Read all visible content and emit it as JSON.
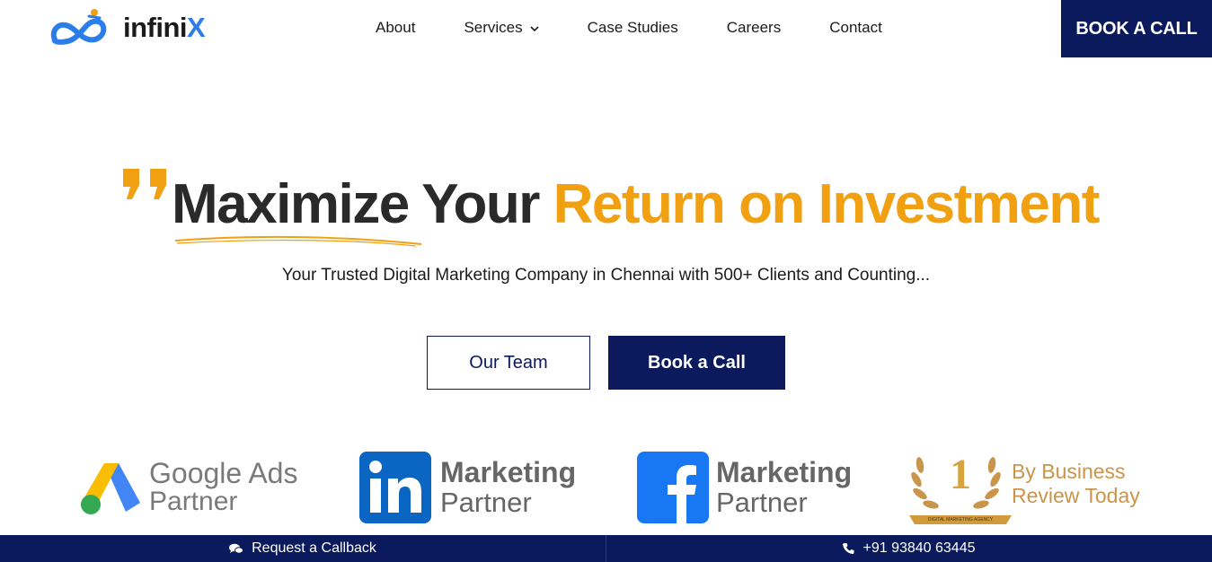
{
  "brand": {
    "name_prefix": "infini",
    "name_suffix": "X",
    "accent_color": "#2b7de9"
  },
  "nav": {
    "items": [
      {
        "label": "About"
      },
      {
        "label": "Services",
        "has_dropdown": true
      },
      {
        "label": "Case Studies"
      },
      {
        "label": "Careers"
      },
      {
        "label": "Contact"
      }
    ],
    "cta_label": "BOOK A CALL"
  },
  "hero": {
    "headline_dark": "Maximize Your",
    "headline_accent": "Return on Investment",
    "subtitle": "Your Trusted Digital Marketing Company in Chennai with 500+ Clients and Counting...",
    "buttons": {
      "team_label": "Our Team",
      "book_label": "Book a Call"
    },
    "colors": {
      "navy": "#0a1a5c",
      "orange": "#f0a011"
    }
  },
  "partners": [
    {
      "icon": "google-ads-icon",
      "line1": "Google Ads",
      "line2": "Partner"
    },
    {
      "icon": "linkedin-icon",
      "line1": "Marketing",
      "line2": "Partner"
    },
    {
      "icon": "facebook-icon",
      "line1": "Marketing",
      "line2": "Partner"
    },
    {
      "icon": "award-laurel-icon",
      "line1": "By Business",
      "line2": "Review Today",
      "badge_number": "1",
      "badge_caption": "DIGITAL MARKETING AGENCY"
    }
  ],
  "bottom_bar": {
    "callback_label": "Request a Callback",
    "phone": "+91 93840 63445"
  }
}
